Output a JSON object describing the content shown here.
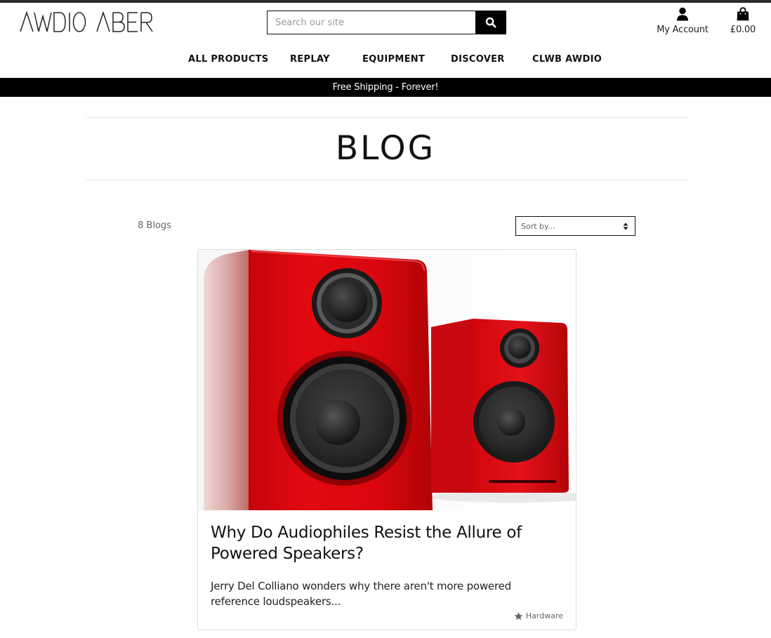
{
  "header": {
    "logo_text": "AWDIO ABER",
    "search": {
      "placeholder": "Search our site",
      "value": ""
    },
    "account_label": "My Account",
    "cart_total": "£0.00",
    "icons": {
      "search": "search-icon",
      "account": "user-icon",
      "cart": "shopping-bag-icon"
    }
  },
  "nav": {
    "items": [
      {
        "label": "ALL PRODUCTS"
      },
      {
        "label": "REPLAY"
      },
      {
        "label": "EQUIPMENT"
      },
      {
        "label": "DISCOVER"
      },
      {
        "label": "CLWB AWDIO"
      }
    ]
  },
  "banner": {
    "text": "Free Shipping - Forever!"
  },
  "page": {
    "title": "BLOG"
  },
  "toolbar": {
    "count_text": "8 Blogs",
    "sort_selected": "Sort by..."
  },
  "posts": [
    {
      "title": "Why Do Audiophiles Resist the Allure of Powered Speakers?",
      "excerpt": "Jerry Del Colliano wonders why there aren't more powered reference loudspeakers...",
      "category": "Hardware",
      "image": "red-powered-speakers-photo",
      "tag_icon": "star-icon"
    }
  ],
  "colors": {
    "banner_bg": "#000000",
    "speaker_red": "#d4080e",
    "text": "#111111"
  }
}
